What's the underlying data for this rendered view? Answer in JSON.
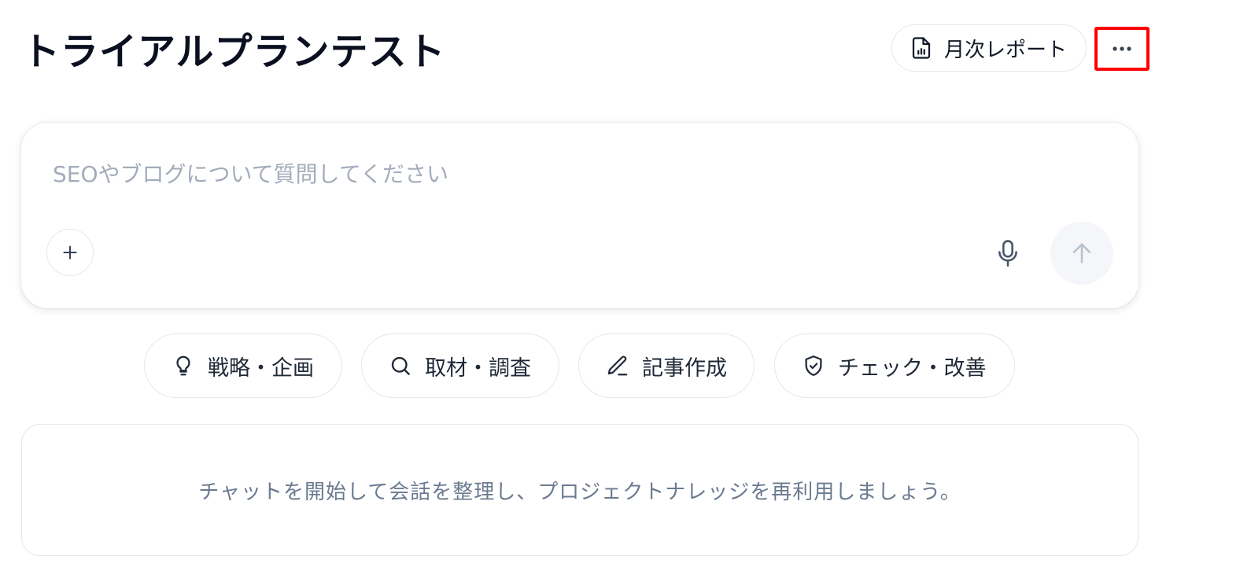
{
  "header": {
    "title": "トライアルプランテスト",
    "report_button_label": "月次レポート",
    "report_icon": "file-chart-icon",
    "more_icon": "more-horizontal-icon"
  },
  "composer": {
    "placeholder": "SEOやブログについて質問してください",
    "add_icon": "plus-icon",
    "mic_icon": "microphone-icon",
    "send_icon": "arrow-up-icon"
  },
  "suggestions": [
    {
      "label": "戦略・企画",
      "icon": "lightbulb-icon"
    },
    {
      "label": "取材・調査",
      "icon": "search-icon"
    },
    {
      "label": "記事作成",
      "icon": "pencil-icon"
    },
    {
      "label": "チェック・改善",
      "icon": "shield-check-icon"
    }
  ],
  "empty_state": {
    "message": "チャットを開始して会話を整理し、プロジェクトナレッジを再利用しましょう。"
  },
  "colors": {
    "highlight_border": "#ff0000",
    "placeholder_text": "#a3acba",
    "muted_text": "#6b7a90"
  }
}
